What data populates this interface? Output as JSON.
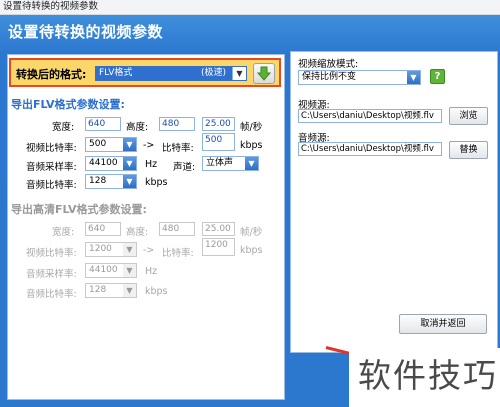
{
  "window": {
    "title": "设置待转换的视频参数"
  },
  "header": {
    "title": "设置待转换的视频参数"
  },
  "format": {
    "label": "转换后的格式:",
    "value": "FLV格式",
    "mode": "(极速)"
  },
  "flv": {
    "section": "导出FLV格式参数设置:",
    "width_label": "宽度:",
    "width": "640",
    "height_label": "高度:",
    "height": "480",
    "fps": "25.00",
    "fps_unit": "帧/秒",
    "vbitrate_label": "视频比特率:",
    "vbitrate": "500",
    "arrow": "->",
    "bitrate_label": "比特率:",
    "bitrate": "500",
    "kbps": "kbps",
    "samplerate_label": "音频采样率:",
    "samplerate": "44100",
    "hz": "Hz",
    "channel_label": "声道:",
    "channel": "立体声",
    "abitrate_label": "音频比特率:",
    "abitrate": "128",
    "abitrate_unit": "kbps"
  },
  "hd": {
    "section": "导出高清FLV格式参数设置:",
    "width_label": "宽度:",
    "width": "640",
    "height_label": "高度:",
    "height": "480",
    "fps": "25.00",
    "fps_unit": "帧/秒",
    "vbitrate_label": "视频比特率:",
    "vbitrate": "1200",
    "arrow": "->",
    "bitrate_label": "比特率:",
    "bitrate": "1200",
    "kbps": "kbps",
    "samplerate_label": "音频采样率:",
    "samplerate": "44100",
    "hz": "Hz",
    "abitrate_label": "音频比特率:",
    "abitrate": "128",
    "abitrate_unit": "kbps"
  },
  "scale": {
    "label": "视频缩放模式:",
    "value": "保持比例不变",
    "help": "?"
  },
  "video_source": {
    "label": "视频源:",
    "path": "C:\\Users\\daniu\\Desktop\\视频.flv",
    "button": "浏览"
  },
  "audio_source": {
    "label": "音频源:",
    "path": "C:\\Users\\daniu\\Desktop\\视频.flv",
    "button": "替换"
  },
  "cancel_button": "取消并返回",
  "watermark": "软件技巧"
}
